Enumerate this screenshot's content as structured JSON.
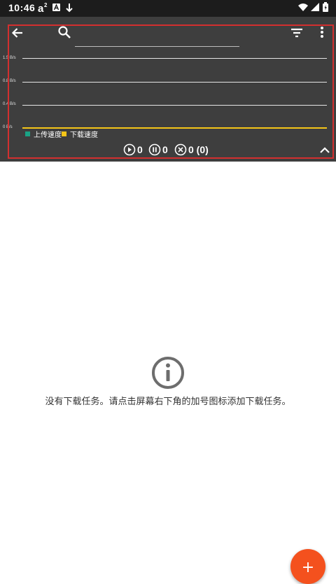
{
  "status_bar": {
    "time": "10:46",
    "icons": [
      "text-a-superscript-icon",
      "photo-a-icon",
      "download-arrow-icon",
      "wifi-icon",
      "signal-icon",
      "battery-icon"
    ]
  },
  "toolbar": {
    "back_icon": "arrow-left-icon",
    "search_icon": "search-icon",
    "filter_icon": "filter-icon",
    "more_icon": "more-vertical-icon"
  },
  "speed_chart": {
    "y_ticks": [
      "1.5 B/s",
      "0.8 B/s",
      "0.4 B/s",
      "0 B/s"
    ],
    "legend": [
      {
        "label": "上传速度",
        "color": "#1aa385"
      },
      {
        "label": "下载速度",
        "color": "#f5c518"
      }
    ],
    "upload_line_color": "#e6e6e6",
    "download_line_color": "#f5c518"
  },
  "counters": {
    "running": "0",
    "paused": "0",
    "failed": "0 (0)"
  },
  "empty_state": {
    "icon": "info-icon",
    "message": "没有下载任务。请点击屏幕右下角的加号图标添加下载任务。"
  },
  "fab": {
    "label": "+"
  },
  "colors": {
    "top_panel": "#3e3e3e",
    "status_bar": "#1c1c1c",
    "accent": "#f4511e",
    "highlight": "#d32f2f"
  }
}
